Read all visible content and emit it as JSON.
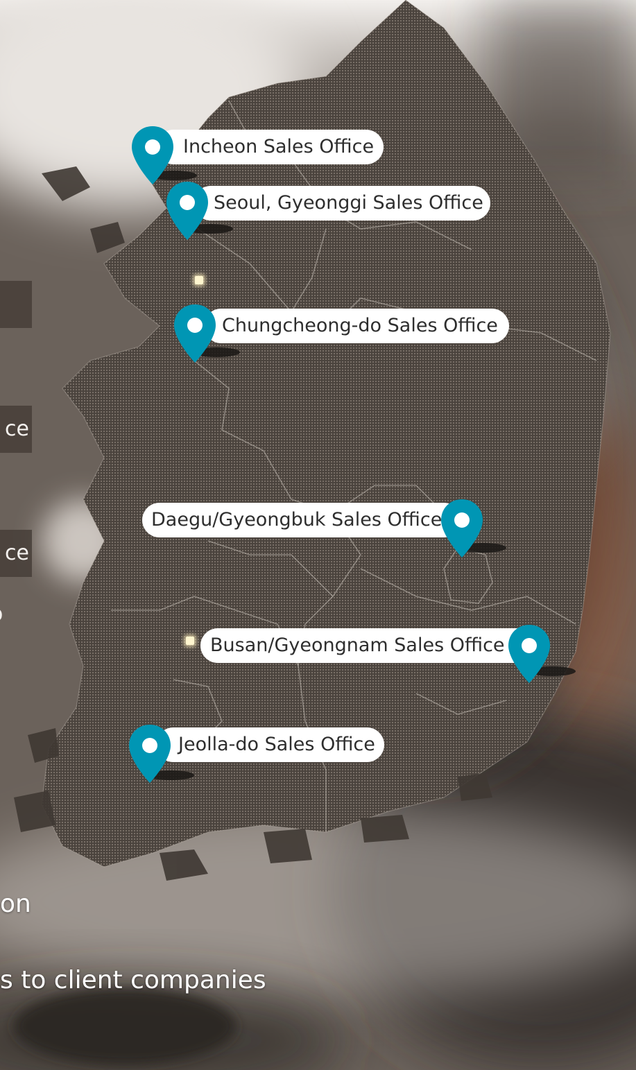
{
  "offices": [
    {
      "id": "incheon",
      "label": "Incheon Sales Office"
    },
    {
      "id": "seoul",
      "label": "Seoul, Gyeonggi Sales Office"
    },
    {
      "id": "chungcheong",
      "label": "Chungcheong-do Sales Office"
    },
    {
      "id": "daegu",
      "label": "Daegu/Gyeongbuk Sales Office"
    },
    {
      "id": "busan",
      "label": "Busan/Gyeongnam Sales Office"
    },
    {
      "id": "jeolla",
      "label": "Jeolla-do Sales Office"
    }
  ],
  "side_fragments": {
    "frag2": "ce",
    "frag3": "ce",
    "frag4": "o"
  },
  "bottom_fragments": {
    "line1": "on",
    "line2": "s to client companies"
  },
  "colors": {
    "pin": "#0096b4",
    "label_bg": "#ffffff",
    "label_text": "#2e2e2e"
  },
  "icons": {
    "pin": "map-pin-icon"
  }
}
